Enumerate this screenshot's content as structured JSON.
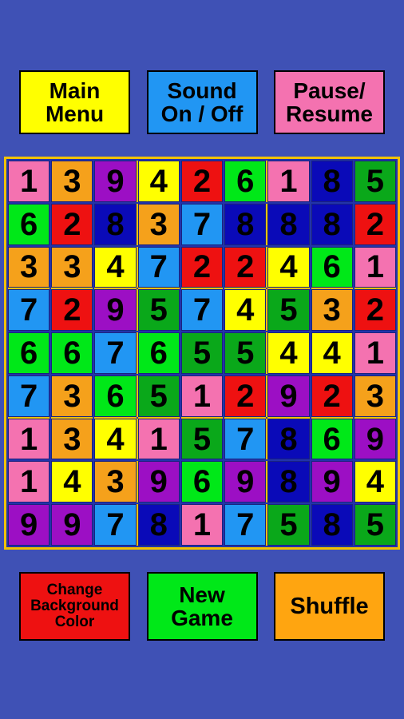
{
  "app": {
    "background_color": "#3f51b5"
  },
  "top_buttons": [
    {
      "id": "main-menu",
      "lines": [
        "Main",
        "Menu"
      ],
      "color": "#ffff00"
    },
    {
      "id": "sound",
      "lines": [
        "Sound",
        "On / Off"
      ],
      "color": "#2196f3"
    },
    {
      "id": "pause",
      "lines": [
        "Pause/",
        "Resume"
      ],
      "color": "#f472b0"
    }
  ],
  "bottom_buttons": [
    {
      "id": "change-background-color",
      "lines": [
        "Change",
        "Background",
        "Color"
      ],
      "color": "#ee1111"
    },
    {
      "id": "new-game",
      "lines": [
        "New",
        "Game"
      ],
      "color": "#00e818"
    },
    {
      "id": "shuffle",
      "lines": [
        "Shuffle"
      ],
      "color": "#ffa510"
    }
  ],
  "grid": {
    "rows": 9,
    "cols": 9,
    "border_color": "#f2c200",
    "gap_color": "#2233aa",
    "palette": {
      "pink": "#f472b0",
      "orange": "#f5a11b",
      "purple": "#9c0fc4",
      "yellow": "#ffff00",
      "red": "#ee1111",
      "green": "#00e818",
      "blue": "#2196f3",
      "navy": "#0a0ab8",
      "darkgreen": "#0aa81a"
    },
    "cells": [
      [
        {
          "v": "1",
          "c": "pink"
        },
        {
          "v": "3",
          "c": "orange"
        },
        {
          "v": "9",
          "c": "purple"
        },
        {
          "v": "4",
          "c": "yellow"
        },
        {
          "v": "2",
          "c": "red"
        },
        {
          "v": "6",
          "c": "green"
        },
        {
          "v": "1",
          "c": "pink"
        },
        {
          "v": "8",
          "c": "navy"
        },
        {
          "v": "5",
          "c": "darkgreen"
        }
      ],
      [
        {
          "v": "6",
          "c": "green"
        },
        {
          "v": "2",
          "c": "red"
        },
        {
          "v": "8",
          "c": "navy"
        },
        {
          "v": "3",
          "c": "orange"
        },
        {
          "v": "7",
          "c": "blue"
        },
        {
          "v": "8",
          "c": "navy"
        },
        {
          "v": "8",
          "c": "navy"
        },
        {
          "v": "8",
          "c": "navy"
        },
        {
          "v": "2",
          "c": "red"
        }
      ],
      [
        {
          "v": "3",
          "c": "orange"
        },
        {
          "v": "3",
          "c": "orange"
        },
        {
          "v": "4",
          "c": "yellow"
        },
        {
          "v": "7",
          "c": "blue"
        },
        {
          "v": "2",
          "c": "red"
        },
        {
          "v": "2",
          "c": "red"
        },
        {
          "v": "4",
          "c": "yellow"
        },
        {
          "v": "6",
          "c": "green"
        },
        {
          "v": "1",
          "c": "pink"
        }
      ],
      [
        {
          "v": "7",
          "c": "blue"
        },
        {
          "v": "2",
          "c": "red"
        },
        {
          "v": "9",
          "c": "purple"
        },
        {
          "v": "5",
          "c": "darkgreen"
        },
        {
          "v": "7",
          "c": "blue"
        },
        {
          "v": "4",
          "c": "yellow"
        },
        {
          "v": "5",
          "c": "darkgreen"
        },
        {
          "v": "3",
          "c": "orange"
        },
        {
          "v": "2",
          "c": "red"
        }
      ],
      [
        {
          "v": "6",
          "c": "green"
        },
        {
          "v": "6",
          "c": "green"
        },
        {
          "v": "7",
          "c": "blue"
        },
        {
          "v": "6",
          "c": "green"
        },
        {
          "v": "5",
          "c": "darkgreen"
        },
        {
          "v": "5",
          "c": "darkgreen"
        },
        {
          "v": "4",
          "c": "yellow"
        },
        {
          "v": "4",
          "c": "yellow"
        },
        {
          "v": "1",
          "c": "pink"
        }
      ],
      [
        {
          "v": "7",
          "c": "blue"
        },
        {
          "v": "3",
          "c": "orange"
        },
        {
          "v": "6",
          "c": "green"
        },
        {
          "v": "5",
          "c": "darkgreen"
        },
        {
          "v": "1",
          "c": "pink"
        },
        {
          "v": "2",
          "c": "red"
        },
        {
          "v": "9",
          "c": "purple"
        },
        {
          "v": "2",
          "c": "red"
        },
        {
          "v": "3",
          "c": "orange"
        }
      ],
      [
        {
          "v": "1",
          "c": "pink"
        },
        {
          "v": "3",
          "c": "orange"
        },
        {
          "v": "4",
          "c": "yellow"
        },
        {
          "v": "1",
          "c": "pink"
        },
        {
          "v": "5",
          "c": "darkgreen"
        },
        {
          "v": "7",
          "c": "blue"
        },
        {
          "v": "8",
          "c": "navy"
        },
        {
          "v": "6",
          "c": "green"
        },
        {
          "v": "9",
          "c": "purple"
        }
      ],
      [
        {
          "v": "1",
          "c": "pink"
        },
        {
          "v": "4",
          "c": "yellow"
        },
        {
          "v": "3",
          "c": "orange"
        },
        {
          "v": "9",
          "c": "purple"
        },
        {
          "v": "6",
          "c": "green"
        },
        {
          "v": "9",
          "c": "purple"
        },
        {
          "v": "8",
          "c": "navy"
        },
        {
          "v": "9",
          "c": "purple"
        },
        {
          "v": "4",
          "c": "yellow"
        }
      ],
      [
        {
          "v": "9",
          "c": "purple"
        },
        {
          "v": "9",
          "c": "purple"
        },
        {
          "v": "7",
          "c": "blue"
        },
        {
          "v": "8",
          "c": "navy"
        },
        {
          "v": "1",
          "c": "pink"
        },
        {
          "v": "7",
          "c": "blue"
        },
        {
          "v": "5",
          "c": "darkgreen"
        },
        {
          "v": "8",
          "c": "navy"
        },
        {
          "v": "5",
          "c": "darkgreen"
        }
      ]
    ]
  }
}
